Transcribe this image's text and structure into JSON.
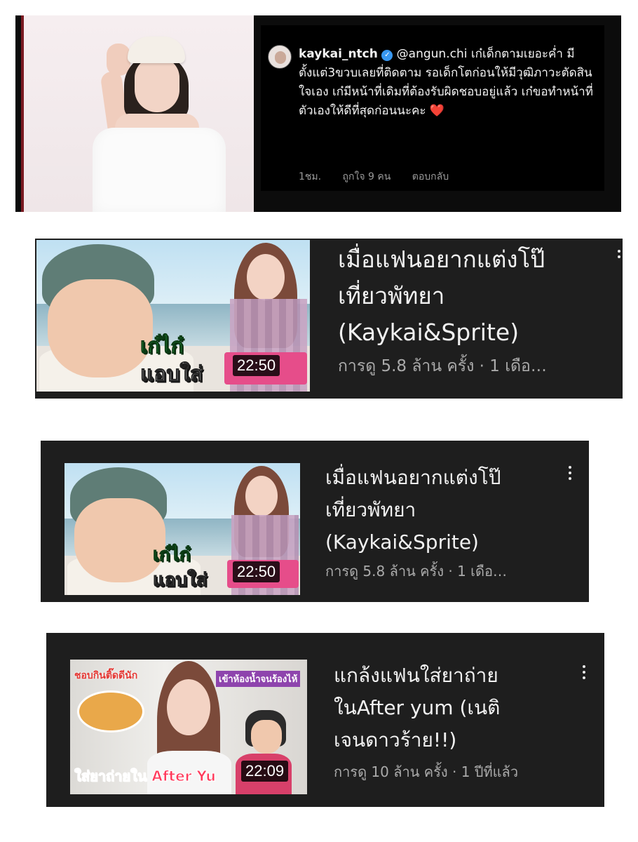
{
  "comment": {
    "username": "kaykai_ntch",
    "mention": "@angun.chi",
    "body": "เก๋เด็กตามเยอะค่ำ มีตั้งแต่3ขวบเลยที่ติดตาม รอเด็กโตก่อนให้มีวุฒิภาวะตัดสินใจเอง เก๋มีหน้าที่เดิมที่ต้องรับผิดชอบอยู่แล้ว เก๋ขอทำหน้าที่ตัวเองให้ดีที่สุดก่อนนะคะ",
    "emoji": "❤️",
    "time": "1ชม.",
    "likes": "ถูกใจ 9 คน",
    "reply": "ตอบกลับ"
  },
  "videos": [
    {
      "title_line1": "เมื่อแฟนอยากแต่งโป๊",
      "title_line2": "เที่ยวพัทยา",
      "title_line3": "(Kaykai&Sprite)",
      "meta": "การดู 5.8 ล้าน ครั้ง · 1 เดือ…",
      "duration": "22:50",
      "thumb_text1": "เก๋ไก๋",
      "thumb_text2": "แอบใส่"
    },
    {
      "title_line1": "เมื่อแฟนอยากแต่งโป๊",
      "title_line2": "เที่ยวพัทยา",
      "title_line3": "(Kaykai&Sprite)",
      "meta": "การดู 5.8 ล้าน ครั้ง · 1 เดือ…",
      "duration": "22:50",
      "thumb_text1": "เก๋ไก๋",
      "thumb_text2": "แอบใส่"
    },
    {
      "title_line1": "แกล้งแฟนใส่ยาถ่าย",
      "title_line2": "ในAfter yum (เนติ",
      "title_line3": "เจนดาวร้าย!!)",
      "meta": "การดู 10 ล้าน ครั้ง · 1 ปีที่แล้ว",
      "duration": "22:09",
      "thumb_text1": "ชอบกินติ๊ดดีนัก",
      "thumb_text2": "ใส่ยาถ่ายใน After Yu",
      "thumb_text3": "เข้าห้องน้ำจนร้องไห้"
    }
  ],
  "colors": {
    "panel": "#1e1e1e",
    "comment_bg": "#000000",
    "verified": "#3897f0",
    "thumb_green": "#39d353",
    "thumb_pink": "#e64d8a"
  }
}
